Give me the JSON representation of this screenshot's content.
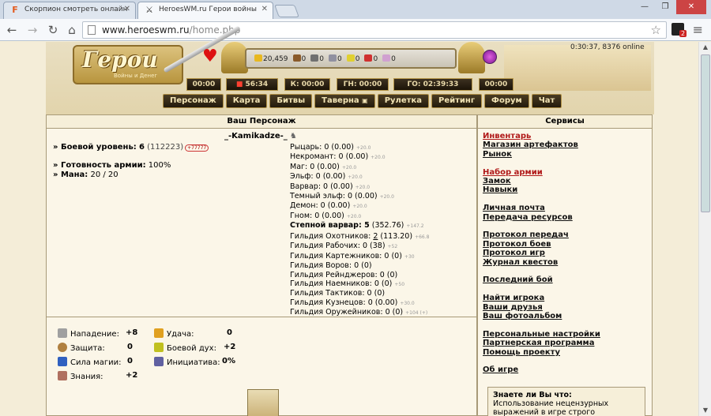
{
  "browser": {
    "tabs": [
      {
        "label": "Скорпион смотреть онлайн",
        "icon": "F",
        "color": "#e35a1c"
      },
      {
        "label": "HeroesWM.ru Герои войны",
        "icon": "⚔",
        "color": "#333"
      }
    ],
    "url_host": "www.heroeswm.ru",
    "url_path": "/home.php",
    "extension_badge": "2"
  },
  "header": {
    "logo_text": "Герои",
    "logo_sub": "Войны и Денег",
    "clock_online": "0:30:37, 8376 online",
    "resources": [
      {
        "name": "gold",
        "value": "20,459",
        "color": "#e8b820"
      },
      {
        "name": "wood",
        "value": "0",
        "color": "#8a5a2a"
      },
      {
        "name": "ore",
        "value": "0",
        "color": "#707070"
      },
      {
        "name": "mercury",
        "value": "0",
        "color": "#9090a0"
      },
      {
        "name": "sulfur",
        "value": "0",
        "color": "#e0d030"
      },
      {
        "name": "crystals",
        "value": "0",
        "color": "#d03030"
      },
      {
        "name": "gems",
        "value": "0",
        "color": "#d0a0d0"
      }
    ],
    "timers": [
      {
        "text": "00:00"
      },
      {
        "text_red": "",
        "text": "56:34"
      },
      {
        "text": "К: 00:00"
      },
      {
        "text": "ГН: 00:00"
      },
      {
        "text": "ГО: 02:39:33"
      },
      {
        "text": "00:00"
      }
    ],
    "menu": [
      "Персонаж",
      "Карта",
      "Битвы",
      "Таверна",
      "Рулетка",
      "Рейтинг",
      "Форум",
      "Чат"
    ]
  },
  "character_panel": {
    "title": "Ваш Персонаж",
    "name": "_-Kamikadze-_",
    "combat_level_label": "» Боевой уровень:",
    "combat_level": "6",
    "experience": "(112223)",
    "experience_extra": "+77777",
    "army_ready_label": "» Готовность армии:",
    "army_ready": "100%",
    "mana_label": "» Мана:",
    "mana": "20 / 20",
    "factions": [
      {
        "text": "Рыцарь: 0 (0.00)",
        "extra": "+20.0"
      },
      {
        "text": "Некромант: 0 (0.00)",
        "extra": "+20.0"
      },
      {
        "text": "Маг: 0 (0.00)",
        "extra": "+20.0"
      },
      {
        "text": "Эльф: 0 (0.00)",
        "extra": "+20.0"
      },
      {
        "text": "Варвар: 0 (0.00)",
        "extra": "+20.0"
      },
      {
        "text": "Темный эльф: 0 (0.00)",
        "extra": "+20.0"
      },
      {
        "text": "Демон: 0 (0.00)",
        "extra": "+20.0"
      },
      {
        "text": "Гном: 0 (0.00)",
        "extra": "+20.0"
      }
    ],
    "main_faction_label": "Степной варвар: 5",
    "main_faction_value": "(352.76)",
    "main_faction_extra": "+147.2",
    "guilds": [
      {
        "text": "Гильдия Охотников: ",
        "link": "2",
        "rest": " (113.20)",
        "extra": "+66.8"
      },
      {
        "text": "Гильдия Рабочих: 0 (38)",
        "link": "",
        "rest": "",
        "extra": "+52"
      },
      {
        "text": "Гильдия Картежников: 0 (0)",
        "link": "",
        "rest": "",
        "extra": "+30"
      },
      {
        "text": "Гильдия Воров: 0 (0)",
        "link": "",
        "rest": "",
        "extra": ""
      },
      {
        "text": "Гильдия Рейнджеров: 0 (0)",
        "link": "",
        "rest": "",
        "extra": ""
      },
      {
        "text": "Гильдия Наемников: 0 (0)",
        "link": "",
        "rest": "",
        "extra": "+50"
      },
      {
        "text": "Гильдия Тактиков: 0 (0)",
        "link": "",
        "rest": "",
        "extra": ""
      },
      {
        "text": "Гильдия Кузнецов: 0 (0.00)",
        "link": "",
        "rest": "",
        "extra": "+30.0"
      },
      {
        "text": "Гильдия Оружейников: 0 (0)",
        "link": "",
        "rest": "",
        "extra": "+104 (+)"
      }
    ],
    "attributes": [
      {
        "label": "Нападение:",
        "value": "+8",
        "color": "#a0a0a0"
      },
      {
        "label": "Защита:",
        "value": "0",
        "color": "#b08040"
      },
      {
        "label": "Сила магии:",
        "value": "0",
        "color": "#3060c0"
      },
      {
        "label": "Знания:",
        "value": "+2",
        "color": "#b07060"
      },
      {
        "label": "Удача:",
        "value": "0",
        "color": "#e0a020"
      },
      {
        "label": "Боевой дух:",
        "value": "+2",
        "color": "#c0c020"
      },
      {
        "label": "Инициатива:",
        "value": "0%",
        "color": "#6060a0"
      }
    ]
  },
  "services_panel": {
    "title": "Сервисы",
    "links": [
      {
        "label": "Инвентарь",
        "red": true,
        "gap": false
      },
      {
        "label": "Магазин артефактов",
        "red": false,
        "gap": false
      },
      {
        "label": "Рынок",
        "red": false,
        "gap": false
      },
      {
        "label": "Набор армии",
        "red": true,
        "gap": true
      },
      {
        "label": "Замок",
        "red": false,
        "gap": false
      },
      {
        "label": "Навыки",
        "red": false,
        "gap": false
      },
      {
        "label": "Личная почта",
        "red": false,
        "gap": true
      },
      {
        "label": "Передача ресурсов",
        "red": false,
        "gap": false
      },
      {
        "label": "Протокол передач",
        "red": false,
        "gap": true
      },
      {
        "label": "Протокол боев",
        "red": false,
        "gap": false
      },
      {
        "label": "Протокол игр",
        "red": false,
        "gap": false
      },
      {
        "label": "Журнал квестов",
        "red": false,
        "gap": false
      },
      {
        "label": "Последний бой",
        "red": false,
        "gap": true
      },
      {
        "label": "Найти игрока",
        "red": false,
        "gap": true
      },
      {
        "label": "Ваши друзья",
        "red": false,
        "gap": false
      },
      {
        "label": "Ваш фотоальбом",
        "red": false,
        "gap": false
      },
      {
        "label": "Персональные настройки",
        "red": false,
        "gap": true
      },
      {
        "label": "Партнерская программа",
        "red": false,
        "gap": false
      },
      {
        "label": "Помощь проекту",
        "red": false,
        "gap": false
      },
      {
        "label": "Об игре",
        "red": false,
        "gap": true
      }
    ],
    "tip_title": "Знаете ли Вы что:",
    "tip_text": "Использование нецензурных выражений в игре строго"
  }
}
